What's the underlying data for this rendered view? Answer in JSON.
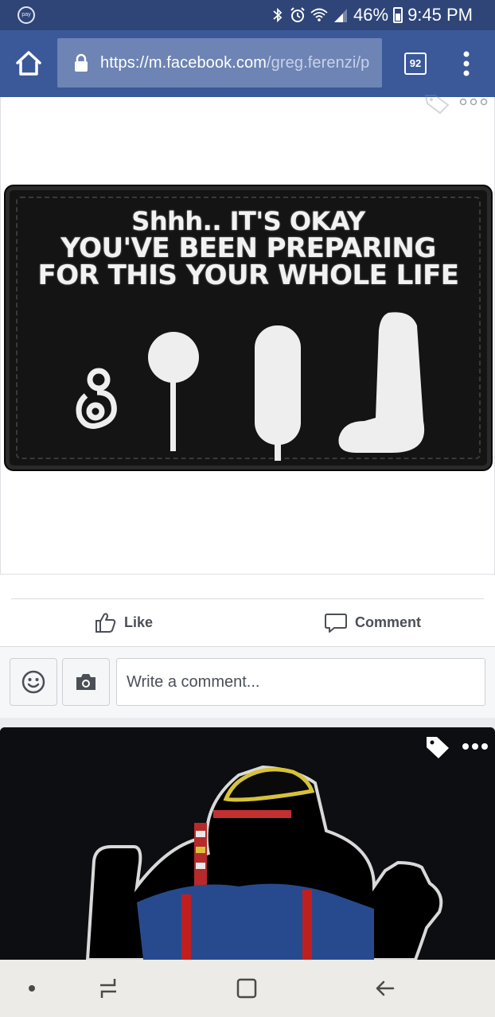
{
  "status_bar": {
    "battery": "46%",
    "time": "9:45 PM",
    "left_icon": "pay"
  },
  "browser": {
    "url_host": "https://m.facebook.com",
    "url_path": "/greg.ferenzi/p",
    "tab_count": "92"
  },
  "post1": {
    "patch_text": {
      "line1": "Shhh.. IT'S OKAY",
      "line2": "YOU'VE BEEN PREPARING",
      "line3": "FOR THIS YOUR WHOLE LIFE"
    },
    "like_label": "Like",
    "comment_label": "Comment"
  },
  "composer": {
    "placeholder": "Write a comment..."
  },
  "icons": {
    "home": "home-icon",
    "lock": "lock-icon",
    "menu": "vertical-dots-icon",
    "tag": "tag-icon",
    "more": "horizontal-dots-icon",
    "like": "thumbs-up-icon",
    "comment": "speech-bubble-icon",
    "emoji": "smiley-icon",
    "camera": "camera-icon"
  },
  "colors": {
    "facebook_blue": "#3b5998",
    "status_bar": "#2f4578"
  }
}
